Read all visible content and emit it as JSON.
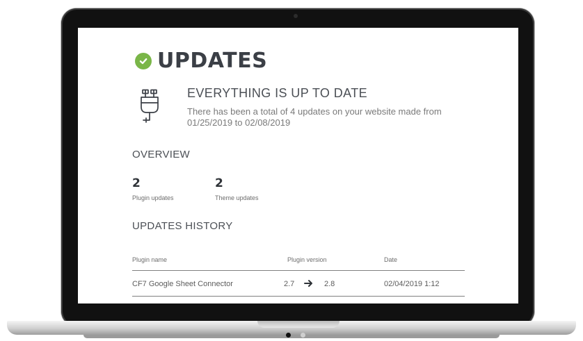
{
  "header": {
    "title": "UPDATES",
    "title_icon": "check-circle-icon",
    "accent_color": "#7ab648"
  },
  "status": {
    "icon": "plug-icon",
    "heading": "EVERYTHING IS UP TO DATE",
    "description": "There has been a total of 4 updates on your website made from 01/25/2019 to 02/08/2019"
  },
  "overview": {
    "title": "OVERVIEW",
    "stats": [
      {
        "value": "2",
        "label": "Plugin updates"
      },
      {
        "value": "2",
        "label": "Theme updates"
      }
    ]
  },
  "history": {
    "title": "UPDATES HISTORY",
    "columns": [
      "Plugin name",
      "Plugin version",
      "Date"
    ],
    "rows": [
      {
        "name": "CF7 Google Sheet Connector",
        "from_version": "2.7",
        "to_version": "2.8",
        "date": "02/04/2019 1:12"
      }
    ]
  },
  "carousel": {
    "total": 2,
    "active_index": 0
  }
}
